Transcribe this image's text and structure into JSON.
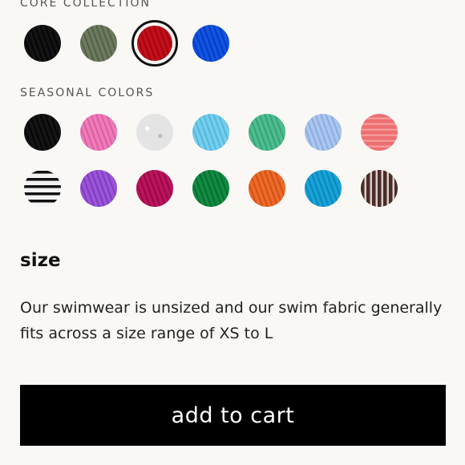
{
  "core": {
    "label": "CORE COLLECTION",
    "swatches": [
      {
        "name": "black",
        "color": "#141414",
        "pattern": "wave"
      },
      {
        "name": "olive",
        "color": "#6d7a60",
        "pattern": "wave"
      },
      {
        "name": "red",
        "color": "#c0101e",
        "pattern": "wave",
        "selected": true
      },
      {
        "name": "blue",
        "color": "#1155e0",
        "pattern": "wave"
      }
    ]
  },
  "seasonal": {
    "label": "SEASONAL COLORS",
    "row1": [
      {
        "name": "black",
        "color": "#151515",
        "pattern": "wave"
      },
      {
        "name": "pink",
        "color": "#f07aba",
        "pattern": "wave"
      },
      {
        "name": "white",
        "color": "#e4e4e4",
        "pattern": "speckle"
      },
      {
        "name": "sky",
        "color": "#72cff0",
        "pattern": "wave"
      },
      {
        "name": "mint",
        "color": "#4fbd90",
        "pattern": "wave"
      },
      {
        "name": "periwinkle",
        "color": "#a9c6f2",
        "pattern": "wave"
      },
      {
        "name": "coral",
        "color": "#ee6f72",
        "pattern": "stripe"
      }
    ],
    "row2": [
      {
        "name": "black-white-stripe",
        "color": "#cfcfcf",
        "pattern": "bw-stripe"
      },
      {
        "name": "purple",
        "color": "#9a55d8",
        "pattern": "wave"
      },
      {
        "name": "magenta",
        "color": "#b8155e",
        "pattern": "wave"
      },
      {
        "name": "green",
        "color": "#128a45",
        "pattern": "wave"
      },
      {
        "name": "orange",
        "color": "#ec6a2c",
        "pattern": "wave"
      },
      {
        "name": "turquoise",
        "color": "#1aa2d6",
        "pattern": "wave"
      },
      {
        "name": "brown-stripe",
        "color": "#4b2c2a",
        "pattern": "brown-stripe"
      }
    ]
  },
  "size": {
    "title": "size",
    "description": "Our swimwear is unsized and our swim fabric generally fits across a size range of XS to L"
  },
  "cart": {
    "label": "add to cart"
  }
}
